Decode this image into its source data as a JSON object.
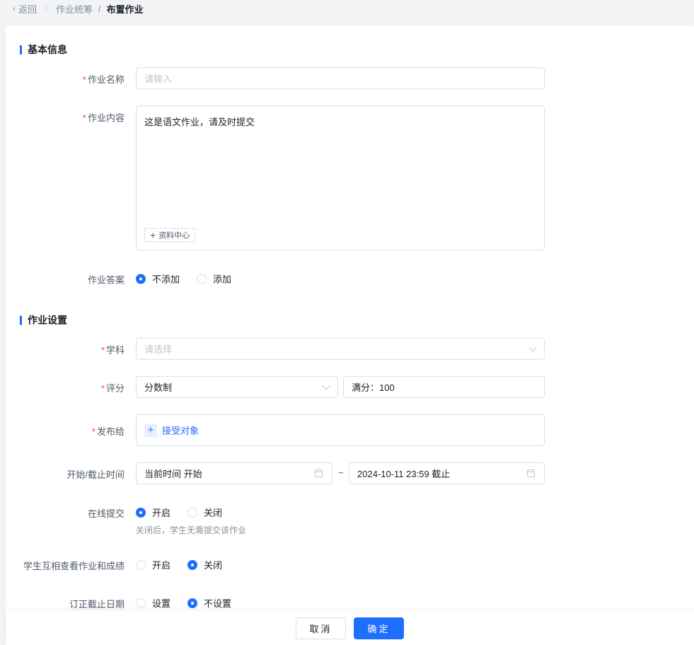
{
  "breadcrumb": {
    "back_label": "返回",
    "parent": "作业统筹",
    "separator": "/",
    "current": "布置作业"
  },
  "sections": {
    "basic": "基本信息",
    "settings": "作业设置"
  },
  "form": {
    "name": {
      "label": "作业名称",
      "placeholder": "请输入"
    },
    "content": {
      "label": "作业内容",
      "value": "这是语文作业，请及时提交",
      "resource_button": "资料中心"
    },
    "answer": {
      "label": "作业答案",
      "options": [
        "不添加",
        "添加"
      ],
      "selected": "不添加"
    },
    "subject": {
      "label": "学科",
      "placeholder": "请选择"
    },
    "score": {
      "label": "评分",
      "type_value": "分数制",
      "full_value": "满分：100"
    },
    "publish": {
      "label": "发布给",
      "button": "接受对象"
    },
    "time": {
      "label": "开始/截止时间",
      "start": "当前时间 开始",
      "end": "2024-10-11 23:59 截止",
      "separator": "~"
    },
    "online": {
      "label": "在线提交",
      "options": [
        "开启",
        "关闭"
      ],
      "selected": "开启",
      "hint": "关闭后，学生无需提交该作业"
    },
    "peer": {
      "label": "学生互相查看作业和成绩",
      "options": [
        "开启",
        "关闭"
      ],
      "selected": "关闭"
    },
    "correction": {
      "label": "订正截止日期",
      "options": [
        "设置",
        "不设置"
      ],
      "selected": "不设置"
    }
  },
  "footer": {
    "cancel": "取消",
    "confirm": "确定"
  },
  "colors": {
    "primary": "#1f6fff",
    "required": "#f53f3f"
  }
}
